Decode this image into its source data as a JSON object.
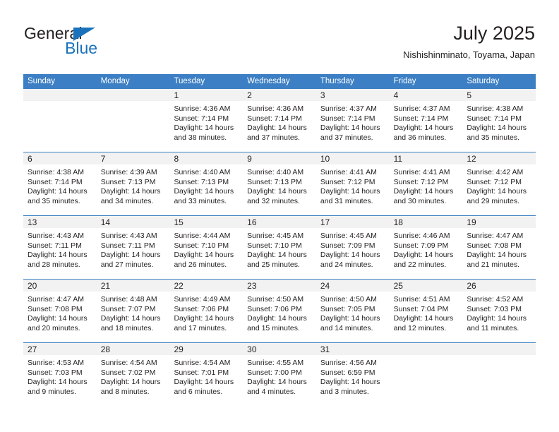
{
  "brand": {
    "name_part1": "General",
    "name_part2": "Blue"
  },
  "header": {
    "title": "July 2025",
    "subtitle": "Nishishinminato, Toyama, Japan"
  },
  "colors": {
    "header_blue": "#3c7fc4",
    "logo_blue": "#1a72bb",
    "band_gray": "#f2f2f2",
    "text": "#231f20"
  },
  "weekdays": [
    "Sunday",
    "Monday",
    "Tuesday",
    "Wednesday",
    "Thursday",
    "Friday",
    "Saturday"
  ],
  "weeks": [
    [
      {
        "num": "",
        "empty": true
      },
      {
        "num": "",
        "empty": true
      },
      {
        "num": "1",
        "sunrise": "Sunrise: 4:36 AM",
        "sunset": "Sunset: 7:14 PM",
        "daylight": "Daylight: 14 hours and 38 minutes."
      },
      {
        "num": "2",
        "sunrise": "Sunrise: 4:36 AM",
        "sunset": "Sunset: 7:14 PM",
        "daylight": "Daylight: 14 hours and 37 minutes."
      },
      {
        "num": "3",
        "sunrise": "Sunrise: 4:37 AM",
        "sunset": "Sunset: 7:14 PM",
        "daylight": "Daylight: 14 hours and 37 minutes."
      },
      {
        "num": "4",
        "sunrise": "Sunrise: 4:37 AM",
        "sunset": "Sunset: 7:14 PM",
        "daylight": "Daylight: 14 hours and 36 minutes."
      },
      {
        "num": "5",
        "sunrise": "Sunrise: 4:38 AM",
        "sunset": "Sunset: 7:14 PM",
        "daylight": "Daylight: 14 hours and 35 minutes."
      }
    ],
    [
      {
        "num": "6",
        "sunrise": "Sunrise: 4:38 AM",
        "sunset": "Sunset: 7:14 PM",
        "daylight": "Daylight: 14 hours and 35 minutes."
      },
      {
        "num": "7",
        "sunrise": "Sunrise: 4:39 AM",
        "sunset": "Sunset: 7:13 PM",
        "daylight": "Daylight: 14 hours and 34 minutes."
      },
      {
        "num": "8",
        "sunrise": "Sunrise: 4:40 AM",
        "sunset": "Sunset: 7:13 PM",
        "daylight": "Daylight: 14 hours and 33 minutes."
      },
      {
        "num": "9",
        "sunrise": "Sunrise: 4:40 AM",
        "sunset": "Sunset: 7:13 PM",
        "daylight": "Daylight: 14 hours and 32 minutes."
      },
      {
        "num": "10",
        "sunrise": "Sunrise: 4:41 AM",
        "sunset": "Sunset: 7:12 PM",
        "daylight": "Daylight: 14 hours and 31 minutes."
      },
      {
        "num": "11",
        "sunrise": "Sunrise: 4:41 AM",
        "sunset": "Sunset: 7:12 PM",
        "daylight": "Daylight: 14 hours and 30 minutes."
      },
      {
        "num": "12",
        "sunrise": "Sunrise: 4:42 AM",
        "sunset": "Sunset: 7:12 PM",
        "daylight": "Daylight: 14 hours and 29 minutes."
      }
    ],
    [
      {
        "num": "13",
        "sunrise": "Sunrise: 4:43 AM",
        "sunset": "Sunset: 7:11 PM",
        "daylight": "Daylight: 14 hours and 28 minutes."
      },
      {
        "num": "14",
        "sunrise": "Sunrise: 4:43 AM",
        "sunset": "Sunset: 7:11 PM",
        "daylight": "Daylight: 14 hours and 27 minutes."
      },
      {
        "num": "15",
        "sunrise": "Sunrise: 4:44 AM",
        "sunset": "Sunset: 7:10 PM",
        "daylight": "Daylight: 14 hours and 26 minutes."
      },
      {
        "num": "16",
        "sunrise": "Sunrise: 4:45 AM",
        "sunset": "Sunset: 7:10 PM",
        "daylight": "Daylight: 14 hours and 25 minutes."
      },
      {
        "num": "17",
        "sunrise": "Sunrise: 4:45 AM",
        "sunset": "Sunset: 7:09 PM",
        "daylight": "Daylight: 14 hours and 24 minutes."
      },
      {
        "num": "18",
        "sunrise": "Sunrise: 4:46 AM",
        "sunset": "Sunset: 7:09 PM",
        "daylight": "Daylight: 14 hours and 22 minutes."
      },
      {
        "num": "19",
        "sunrise": "Sunrise: 4:47 AM",
        "sunset": "Sunset: 7:08 PM",
        "daylight": "Daylight: 14 hours and 21 minutes."
      }
    ],
    [
      {
        "num": "20",
        "sunrise": "Sunrise: 4:47 AM",
        "sunset": "Sunset: 7:08 PM",
        "daylight": "Daylight: 14 hours and 20 minutes."
      },
      {
        "num": "21",
        "sunrise": "Sunrise: 4:48 AM",
        "sunset": "Sunset: 7:07 PM",
        "daylight": "Daylight: 14 hours and 18 minutes."
      },
      {
        "num": "22",
        "sunrise": "Sunrise: 4:49 AM",
        "sunset": "Sunset: 7:06 PM",
        "daylight": "Daylight: 14 hours and 17 minutes."
      },
      {
        "num": "23",
        "sunrise": "Sunrise: 4:50 AM",
        "sunset": "Sunset: 7:06 PM",
        "daylight": "Daylight: 14 hours and 15 minutes."
      },
      {
        "num": "24",
        "sunrise": "Sunrise: 4:50 AM",
        "sunset": "Sunset: 7:05 PM",
        "daylight": "Daylight: 14 hours and 14 minutes."
      },
      {
        "num": "25",
        "sunrise": "Sunrise: 4:51 AM",
        "sunset": "Sunset: 7:04 PM",
        "daylight": "Daylight: 14 hours and 12 minutes."
      },
      {
        "num": "26",
        "sunrise": "Sunrise: 4:52 AM",
        "sunset": "Sunset: 7:03 PM",
        "daylight": "Daylight: 14 hours and 11 minutes."
      }
    ],
    [
      {
        "num": "27",
        "sunrise": "Sunrise: 4:53 AM",
        "sunset": "Sunset: 7:03 PM",
        "daylight": "Daylight: 14 hours and 9 minutes."
      },
      {
        "num": "28",
        "sunrise": "Sunrise: 4:54 AM",
        "sunset": "Sunset: 7:02 PM",
        "daylight": "Daylight: 14 hours and 8 minutes."
      },
      {
        "num": "29",
        "sunrise": "Sunrise: 4:54 AM",
        "sunset": "Sunset: 7:01 PM",
        "daylight": "Daylight: 14 hours and 6 minutes."
      },
      {
        "num": "30",
        "sunrise": "Sunrise: 4:55 AM",
        "sunset": "Sunset: 7:00 PM",
        "daylight": "Daylight: 14 hours and 4 minutes."
      },
      {
        "num": "31",
        "sunrise": "Sunrise: 4:56 AM",
        "sunset": "Sunset: 6:59 PM",
        "daylight": "Daylight: 14 hours and 3 minutes."
      },
      {
        "num": "",
        "empty": true
      },
      {
        "num": "",
        "empty": true
      }
    ]
  ]
}
